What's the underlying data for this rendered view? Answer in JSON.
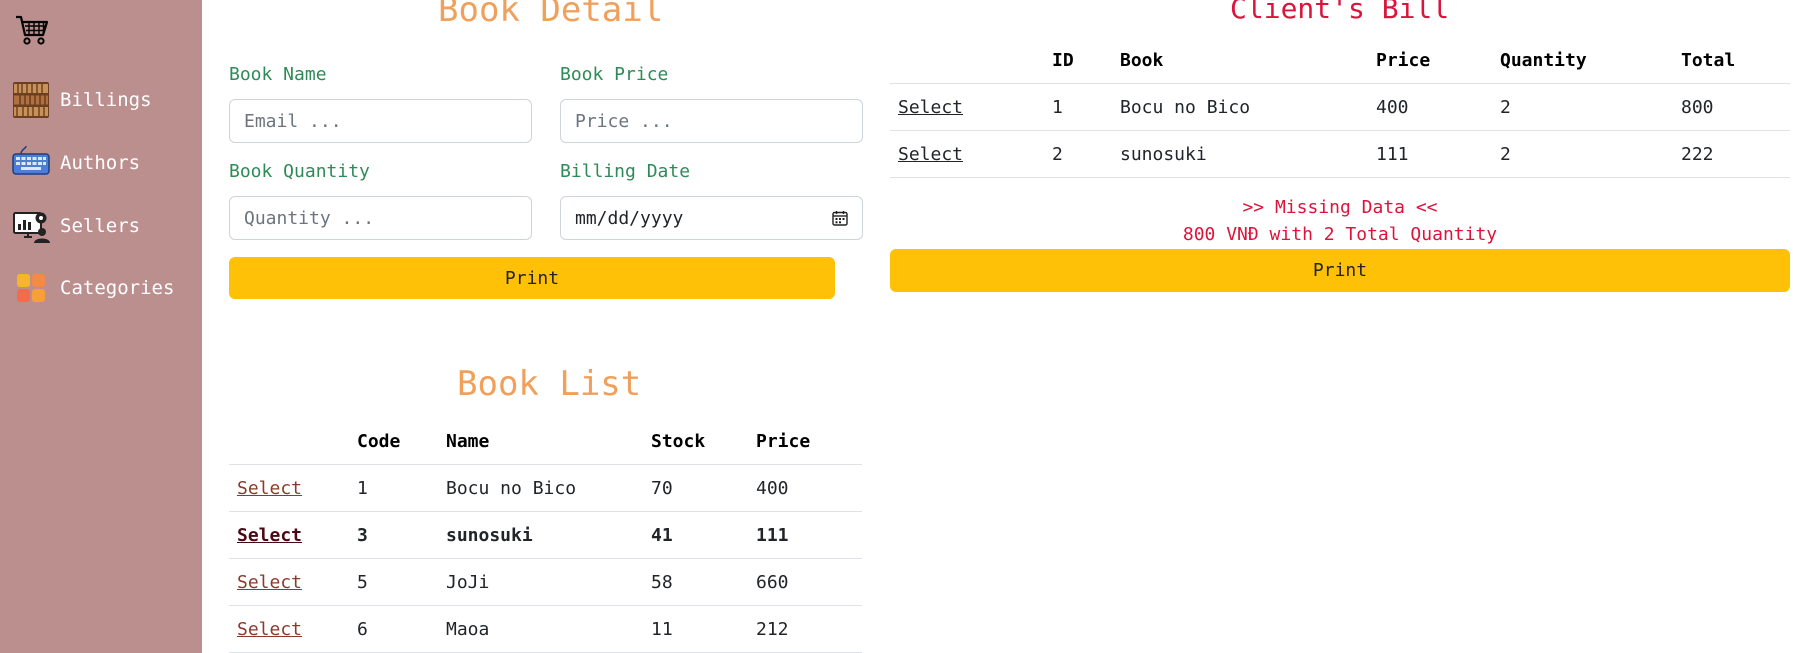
{
  "sidebar": {
    "items": [
      {
        "label": "Billings",
        "icon": "bookshelf-icon"
      },
      {
        "label": "Authors",
        "icon": "keyboard-icon"
      },
      {
        "label": "Sellers",
        "icon": "seller-dashboard-icon"
      },
      {
        "label": "Categories",
        "icon": "category-grid-icon"
      }
    ],
    "logo_icon": "shopping-cart-icon"
  },
  "book_detail": {
    "title": "Book Detail",
    "book_name_label": "Book Name",
    "book_name_placeholder": "Email ...",
    "book_price_label": "Book Price",
    "book_price_placeholder": "Price ...",
    "book_quantity_label": "Book Quantity",
    "book_quantity_placeholder": "Quantity ...",
    "billing_date_label": "Billing Date",
    "billing_date_placeholder": "mm/dd/yyyy",
    "print_label": "Print"
  },
  "book_list": {
    "title": "Book List",
    "columns": [
      "",
      "Code",
      "Name",
      "Stock",
      "Price"
    ],
    "rows": [
      {
        "action": "Select",
        "code": "1",
        "name": "Bocu no Bico",
        "stock": "70",
        "price": "400"
      },
      {
        "action": "Select",
        "code": "3",
        "name": "sunosuki",
        "stock": "41",
        "price": "111"
      },
      {
        "action": "Select",
        "code": "5",
        "name": "JoJi",
        "stock": "58",
        "price": "660"
      },
      {
        "action": "Select",
        "code": "6",
        "name": "Maoa",
        "stock": "11",
        "price": "212"
      }
    ]
  },
  "client_bill": {
    "title": "Client's Bill",
    "columns": [
      "",
      "ID",
      "Book",
      "Price",
      "Quantity",
      "Total"
    ],
    "rows": [
      {
        "action": "Select",
        "id": "1",
        "book": "Bocu no Bico",
        "price": "400",
        "quantity": "2",
        "total": "800"
      },
      {
        "action": "Select",
        "id": "2",
        "book": "sunosuki",
        "price": "111",
        "quantity": "2",
        "total": "222"
      }
    ],
    "missing_data": ">> Missing Data <<",
    "summary": "800 VNĐ with 2 Total Quantity",
    "print_label": "Print"
  },
  "colors": {
    "sidebar_bg": "#bc8f8f",
    "heading_orange": "#f0a05a",
    "heading_red": "#dc143c",
    "label_green": "#2e8b57",
    "button_yellow": "#ffc107"
  }
}
